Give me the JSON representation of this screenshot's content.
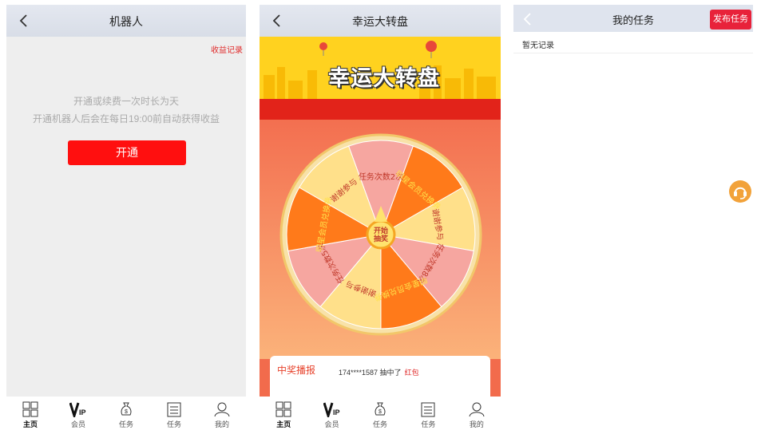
{
  "panel1": {
    "title": "机器人",
    "income_link": "收益记录",
    "desc1": "开通或续费一次时长为天",
    "desc2": "开通机器人后会在每日19:00前自动获得收益",
    "open_button": "开通"
  },
  "panel2": {
    "title": "幸运大转盘",
    "banner_title": "幸运大转盘",
    "wheel_center": "开始抽奖",
    "segments": [
      "任务次数2次",
      "明星会员兑换券",
      "谢谢参与",
      "任务次数8次",
      "明星会员兑换券",
      "谢谢参与",
      "任务次数5次",
      "明星会员兑换券",
      "谢谢参与"
    ],
    "prize_title": "中奖播报",
    "prize_user": "174****1587 抽中了",
    "prize_item": "红包"
  },
  "panel3": {
    "title": "我的任务",
    "publish_button": "发布任务",
    "no_record": "暂无记录"
  },
  "tabbar": {
    "items": [
      {
        "label": "主页",
        "icon": "grid-icon"
      },
      {
        "label": "会员",
        "icon": "vip-icon"
      },
      {
        "label": "任务",
        "icon": "money-bag-icon"
      },
      {
        "label": "任务",
        "icon": "clipboard-icon"
      },
      {
        "label": "我的",
        "icon": "user-icon"
      }
    ]
  },
  "colors": {
    "accent_red": "#ff0f0f",
    "wheel_orange": "#ff7a1a",
    "wheel_pink": "#f6a6a0",
    "wheel_yellow": "#ffe08a"
  }
}
